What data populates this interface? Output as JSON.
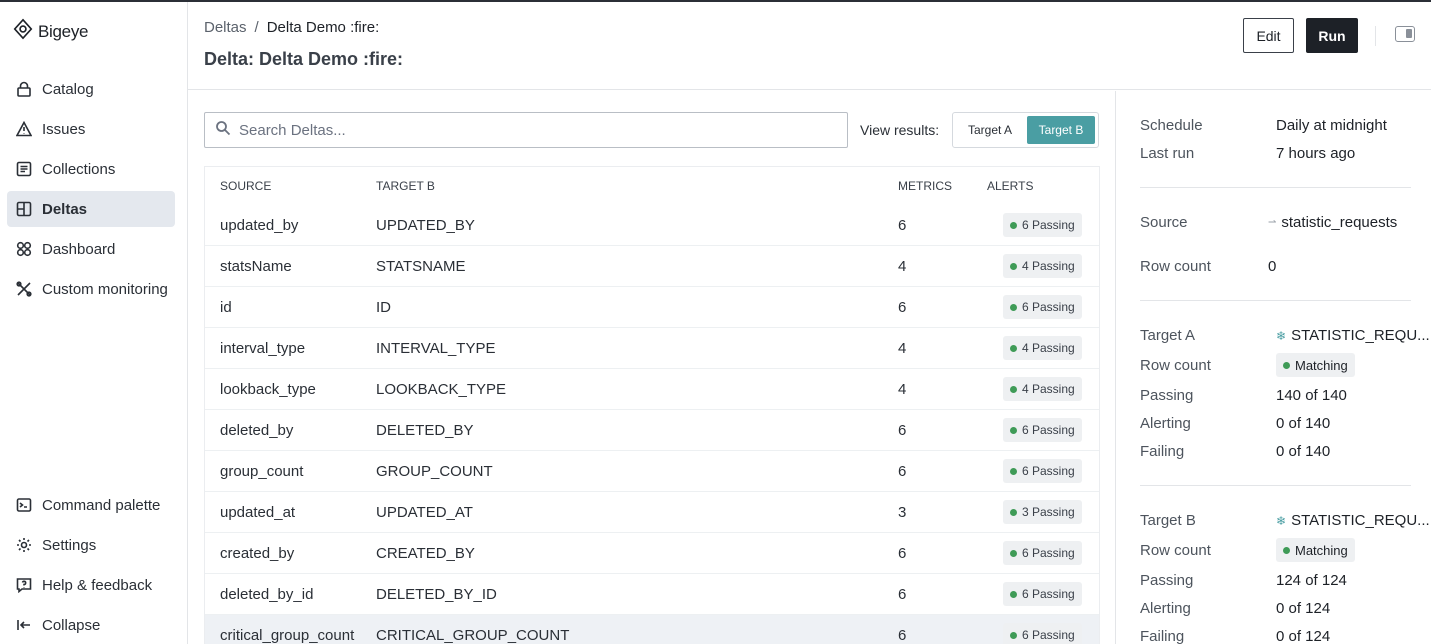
{
  "app": {
    "brand": "Bigeye"
  },
  "sidebar": {
    "items": [
      {
        "label": "Catalog",
        "icon": "lock-icon"
      },
      {
        "label": "Issues",
        "icon": "warning-icon"
      },
      {
        "label": "Collections",
        "icon": "list-icon"
      },
      {
        "label": "Deltas",
        "icon": "delta-icon",
        "active": true
      },
      {
        "label": "Dashboard",
        "icon": "grid-icon"
      },
      {
        "label": "Custom monitoring",
        "icon": "tools-icon"
      }
    ],
    "bottom": [
      {
        "label": "Command palette",
        "icon": "terminal-icon"
      },
      {
        "label": "Settings",
        "icon": "gear-icon"
      },
      {
        "label": "Help & feedback",
        "icon": "help-icon"
      },
      {
        "label": "Collapse",
        "icon": "collapse-icon"
      }
    ]
  },
  "header": {
    "breadcrumb_root": "Deltas",
    "breadcrumb_sep": "/",
    "breadcrumb_current": "Delta Demo :fire:",
    "title": "Delta: Delta Demo :fire:",
    "edit_label": "Edit",
    "run_label": "Run"
  },
  "search": {
    "placeholder": "Search Deltas..."
  },
  "view_results": {
    "label": "View results:",
    "options": [
      "Target A",
      "Target B"
    ],
    "selected": "Target B"
  },
  "table": {
    "columns": [
      "SOURCE",
      "TARGET B",
      "METRICS",
      "ALERTS"
    ],
    "rows": [
      {
        "source": "updated_by",
        "target": "UPDATED_BY",
        "metrics": "6",
        "alerts": "6 Passing"
      },
      {
        "source": "statsName",
        "target": "STATSNAME",
        "metrics": "4",
        "alerts": "4 Passing"
      },
      {
        "source": "id",
        "target": "ID",
        "metrics": "6",
        "alerts": "6 Passing"
      },
      {
        "source": "interval_type",
        "target": "INTERVAL_TYPE",
        "metrics": "4",
        "alerts": "4 Passing"
      },
      {
        "source": "lookback_type",
        "target": "LOOKBACK_TYPE",
        "metrics": "4",
        "alerts": "4 Passing"
      },
      {
        "source": "deleted_by",
        "target": "DELETED_BY",
        "metrics": "6",
        "alerts": "6 Passing"
      },
      {
        "source": "group_count",
        "target": "GROUP_COUNT",
        "metrics": "6",
        "alerts": "6 Passing"
      },
      {
        "source": "updated_at",
        "target": "UPDATED_AT",
        "metrics": "3",
        "alerts": "3 Passing"
      },
      {
        "source": "created_by",
        "target": "CREATED_BY",
        "metrics": "6",
        "alerts": "6 Passing"
      },
      {
        "source": "deleted_by_id",
        "target": "DELETED_BY_ID",
        "metrics": "6",
        "alerts": "6 Passing"
      },
      {
        "source": "critical_group_count",
        "target": "CRITICAL_GROUP_COUNT",
        "metrics": "6",
        "alerts": "6 Passing"
      }
    ]
  },
  "details": {
    "schedule_label": "Schedule",
    "schedule_value": "Daily at midnight",
    "last_run_label": "Last run",
    "last_run_value": "7 hours ago",
    "source_label": "Source",
    "source_value": "statistic_requests",
    "source_row_count_label": "Row count",
    "source_row_count_value": "0",
    "target_a": {
      "label": "Target A",
      "value": "STATISTIC_REQU...",
      "row_count_label": "Row count",
      "row_count_value": "Matching",
      "passing_label": "Passing",
      "passing_value": "140 of 140",
      "alerting_label": "Alerting",
      "alerting_value": "0 of 140",
      "failing_label": "Failing",
      "failing_value": "0 of 140"
    },
    "target_b": {
      "label": "Target B",
      "value": "STATISTIC_REQU...",
      "row_count_label": "Row count",
      "row_count_value": "Matching",
      "passing_label": "Passing",
      "passing_value": "124 of 124",
      "alerting_label": "Alerting",
      "alerting_value": "0 of 124",
      "failing_label": "Failing",
      "failing_value": "0 of 124"
    }
  },
  "colors": {
    "accent": "#4a9ea3",
    "passing": "#3f9b57",
    "primary_button": "#1d2127"
  }
}
